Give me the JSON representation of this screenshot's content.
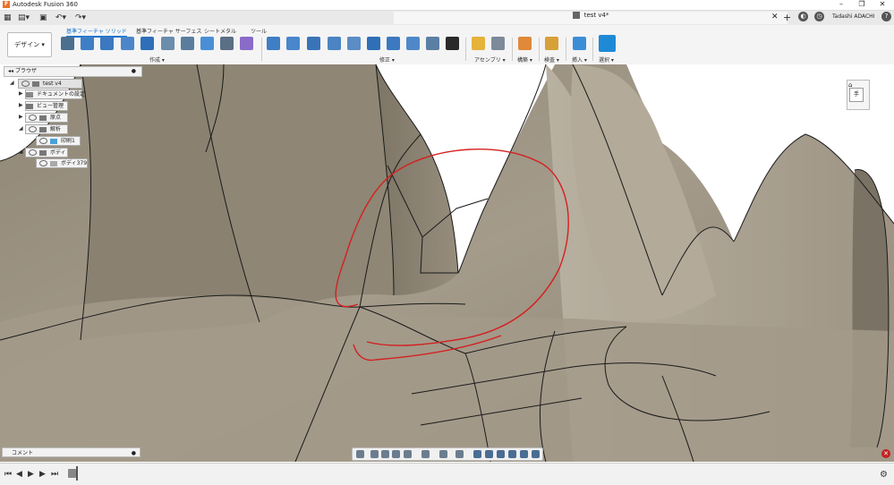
{
  "window": {
    "title": "Autodesk Fusion 360",
    "app_icon": "F"
  },
  "document": {
    "tab_name": "test v4*",
    "user": "Tadashi ADACHI"
  },
  "ribbon": {
    "workspace": "デザイン ▾",
    "tabs": [
      "基準フィーチャ ソリッド",
      "基準フィーチャ サーフェス",
      "シートメタル",
      "ツール"
    ],
    "active_tab_index": 0,
    "groups": [
      "作成 ▾",
      "修正 ▾",
      "アセンブリ ▾",
      "構築 ▾",
      "検査 ▾",
      "挿入 ▾",
      "選択 ▾"
    ]
  },
  "browser": {
    "title": "ブラウザ",
    "root": "test v4",
    "items": [
      "ドキュメントの設定",
      "ビュー管理",
      "原点",
      "解析",
      "印刷1",
      "ボディ",
      "ボディ379"
    ]
  },
  "comments": {
    "label": "コメント"
  },
  "viewcube": {
    "face_label": "手"
  },
  "colors": {
    "accent": "#1473d0",
    "annotation": "#d42020",
    "surface": "#9a9181"
  }
}
